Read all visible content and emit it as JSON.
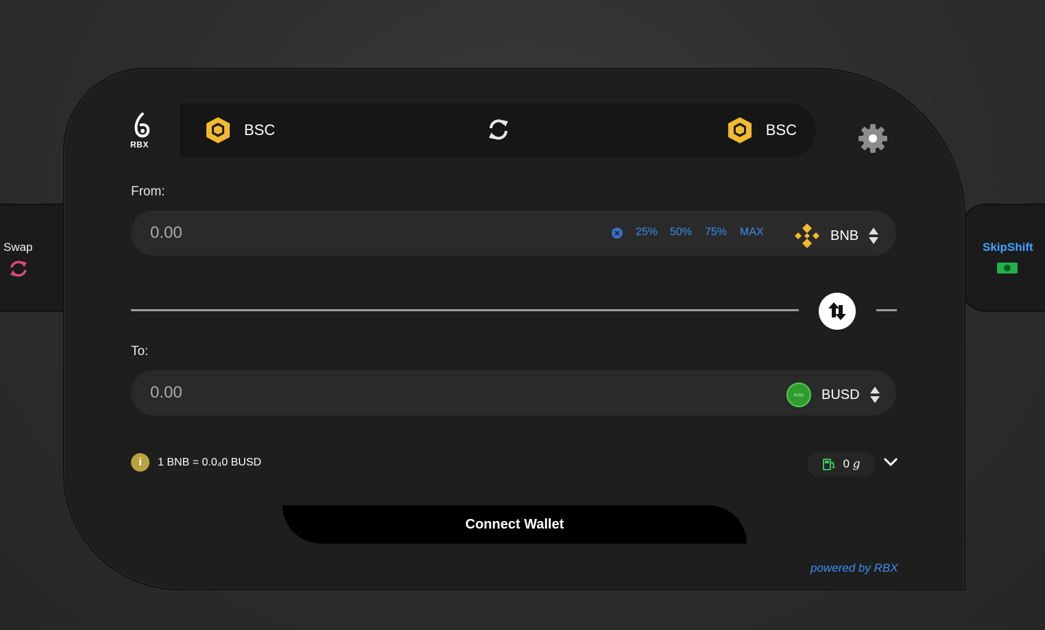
{
  "sidebar_left": {
    "label": "Swap",
    "icon": "swap-cycle-icon"
  },
  "sidebar_right": {
    "label": "SkipShift",
    "icon": "cash-icon"
  },
  "header": {
    "logo_text": "RBX",
    "from_chain": "BSC",
    "to_chain": "BSC"
  },
  "from": {
    "label": "From:",
    "amount_placeholder": "0.00",
    "percents": [
      "25%",
      "50%",
      "75%",
      "MAX"
    ],
    "token": "BNB"
  },
  "to": {
    "label": "To:",
    "amount_placeholder": "0.00",
    "token": "BUSD",
    "token_logo_text": "BUSD"
  },
  "rate": {
    "text": "1 BNB = 0.0₄0 BUSD"
  },
  "gas": {
    "value": "0",
    "unit": "g"
  },
  "connect_button": "Connect Wallet",
  "footer": "powered by RBX",
  "colors": {
    "accent": "#3a8ef0",
    "brand_yellow": "#f3ba2f",
    "busd_green": "#2e9d2e"
  }
}
